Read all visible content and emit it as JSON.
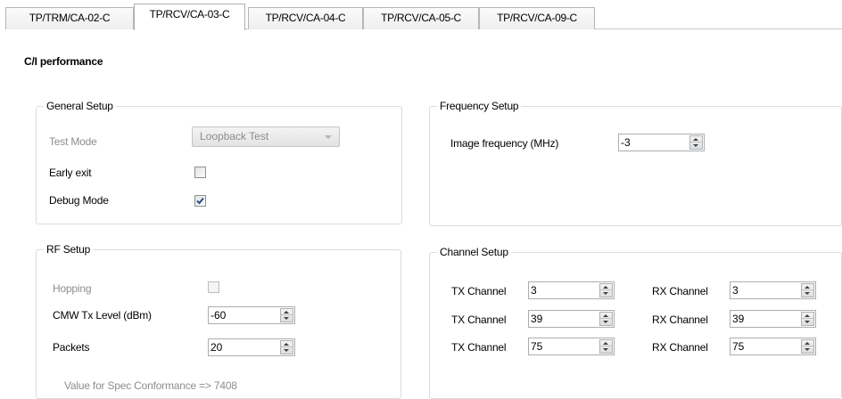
{
  "tabs": [
    {
      "label": "TP/TRM/CA-02-C"
    },
    {
      "label": "TP/RCV/CA-03-C",
      "active": true
    },
    {
      "label": "TP/RCV/CA-04-C"
    },
    {
      "label": "TP/RCV/CA-05-C"
    },
    {
      "label": "TP/RCV/CA-09-C"
    }
  ],
  "section_title": "C/I performance",
  "general_setup": {
    "title": "General Setup",
    "test_mode_label": "Test Mode",
    "test_mode_value": "Loopback Test",
    "early_exit_label": "Early exit",
    "early_exit_checked": false,
    "debug_mode_label": "Debug Mode",
    "debug_mode_checked": true
  },
  "frequency_setup": {
    "title": "Frequency Setup",
    "image_freq_label": "Image frequency (MHz)",
    "image_freq_value": "-3"
  },
  "rf_setup": {
    "title": "RF Setup",
    "hopping_label": "Hopping",
    "hopping_checked": false,
    "cmw_label": "CMW Tx Level (dBm)",
    "cmw_value": "-60",
    "packets_label": "Packets",
    "packets_value": "20",
    "spec_text": "Value for Spec Conformance => 7408"
  },
  "channel_setup": {
    "title": "Channel Setup",
    "tx_label": "TX Channel",
    "rx_label": "RX Channel",
    "rows": [
      {
        "tx": "3",
        "rx": "3"
      },
      {
        "tx": "39",
        "rx": "39"
      },
      {
        "tx": "75",
        "rx": "75"
      }
    ]
  },
  "icons": {
    "checkmark": "checkmark-icon",
    "dropdown": "chevron-down-icon",
    "spin_up": "spin-up-icon",
    "spin_down": "spin-down-icon"
  },
  "colors": {
    "checkmark": "#2a4f91",
    "disabled_text": "#8d8d8d",
    "group_border": "#dcdcdc"
  }
}
